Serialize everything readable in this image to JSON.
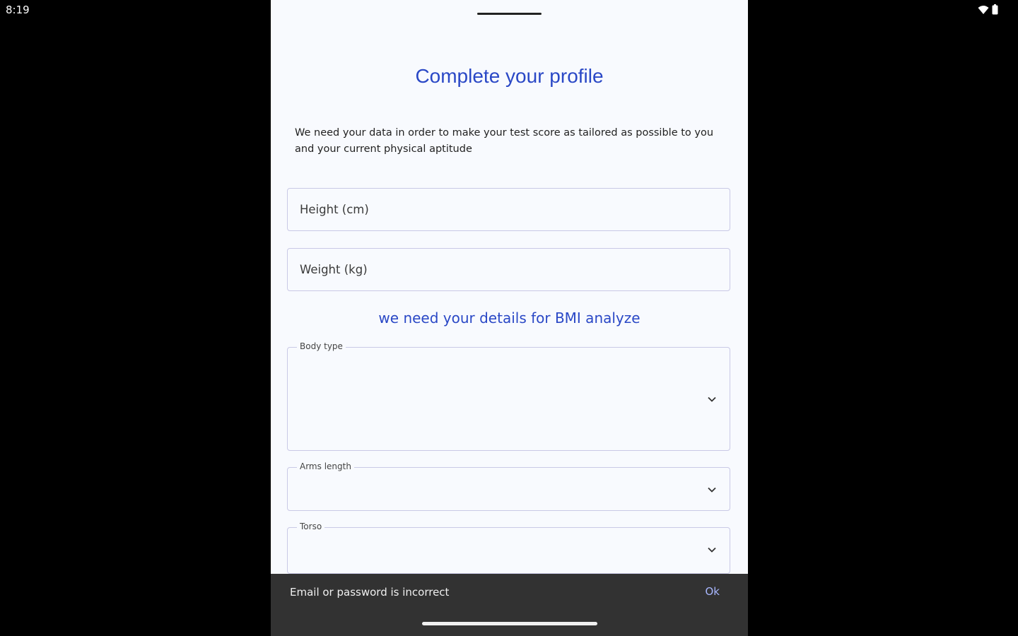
{
  "status_bar": {
    "time": "8:19",
    "icons": [
      "wifi-icon",
      "battery-icon"
    ]
  },
  "profile": {
    "title": "Complete your profile",
    "description": "We need your data in order to make your test score as tailored as possible to you and your current physical aptitude",
    "height_placeholder": "Height (cm)",
    "weight_placeholder": "Weight (kg)",
    "bmi_note": "we need  your details for BMI analyze",
    "body_type_label": "Body type",
    "arms_length_label": "Arms length",
    "torso_label": "Torso"
  },
  "snackbar": {
    "message": "Email or password is incorrect",
    "action": "Ok"
  },
  "colors": {
    "accent": "#2a48c6",
    "sheet_background": "#f8fafe",
    "field_border": "#c9c9e6",
    "snackbar_background": "#323232",
    "snackbar_action": "#a8b7ff"
  }
}
